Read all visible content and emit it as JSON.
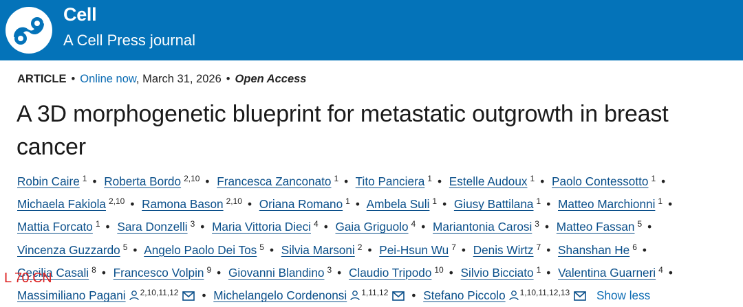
{
  "header": {
    "brand_name": "Cell",
    "brand_subtitle": "A Cell Press journal",
    "brand_color": "#0473b9",
    "logo_icon": "cell-press-logo"
  },
  "article": {
    "type": "ARTICLE",
    "online_label": "Online now",
    "date": ", March 31, 2026",
    "access": "Open Access",
    "title": "A 3D morphogenetic blueprint for metastatic outgrowth in breast cancer"
  },
  "authors": [
    {
      "name": "Robin Caire",
      "aff": "1"
    },
    {
      "name": "Roberta Bordo",
      "aff": "2,10"
    },
    {
      "name": "Francesca Zanconato",
      "aff": "1"
    },
    {
      "name": "Tito Panciera",
      "aff": "1"
    },
    {
      "name": "Estelle Audoux",
      "aff": "1"
    },
    {
      "name": "Paolo Contessotto",
      "aff": "1"
    },
    {
      "name": "Michaela Fakiola",
      "aff": "2,10"
    },
    {
      "name": "Ramona Bason",
      "aff": "2,10"
    },
    {
      "name": "Oriana Romano",
      "aff": "1"
    },
    {
      "name": "Ambela Suli",
      "aff": "1"
    },
    {
      "name": "Giusy Battilana",
      "aff": "1"
    },
    {
      "name": "Matteo Marchionni",
      "aff": "1"
    },
    {
      "name": "Mattia Forcato",
      "aff": "1"
    },
    {
      "name": "Sara Donzelli",
      "aff": "3"
    },
    {
      "name": "Maria Vittoria Dieci",
      "aff": "4"
    },
    {
      "name": "Gaia Griguolo",
      "aff": "4"
    },
    {
      "name": "Mariantonia Carosi",
      "aff": "3"
    },
    {
      "name": "Matteo Fassan",
      "aff": "5"
    },
    {
      "name": "Vincenza Guzzardo",
      "aff": "5"
    },
    {
      "name": "Angelo Paolo Dei Tos",
      "aff": "5"
    },
    {
      "name": "Silvia Marsoni",
      "aff": "2"
    },
    {
      "name": "Pei-Hsun Wu",
      "aff": "7"
    },
    {
      "name": "Denis Wirtz",
      "aff": "7"
    },
    {
      "name": "Shanshan He",
      "aff": "6"
    },
    {
      "name": "Cecilia Casali",
      "aff": "8"
    },
    {
      "name": "Francesco Volpin",
      "aff": "9"
    },
    {
      "name": "Giovanni Blandino",
      "aff": "3"
    },
    {
      "name": "Claudio Tripodo",
      "aff": "10"
    },
    {
      "name": "Silvio Bicciato",
      "aff": "1"
    },
    {
      "name": "Valentina Guarneri",
      "aff": "4"
    },
    {
      "name": "Massimiliano Pagani",
      "aff": "2,10,11,12",
      "corresponding": true
    },
    {
      "name": "Michelangelo Cordenonsi",
      "aff": "1,11,12",
      "corresponding": true
    },
    {
      "name": "Stefano Piccolo",
      "aff": "1,10,11,12,13",
      "corresponding": true
    }
  ],
  "show_less_label": "Show less",
  "separator": "•",
  "watermark": "L 70.CN",
  "icons": {
    "contact": "person-icon",
    "email": "mail-icon"
  }
}
